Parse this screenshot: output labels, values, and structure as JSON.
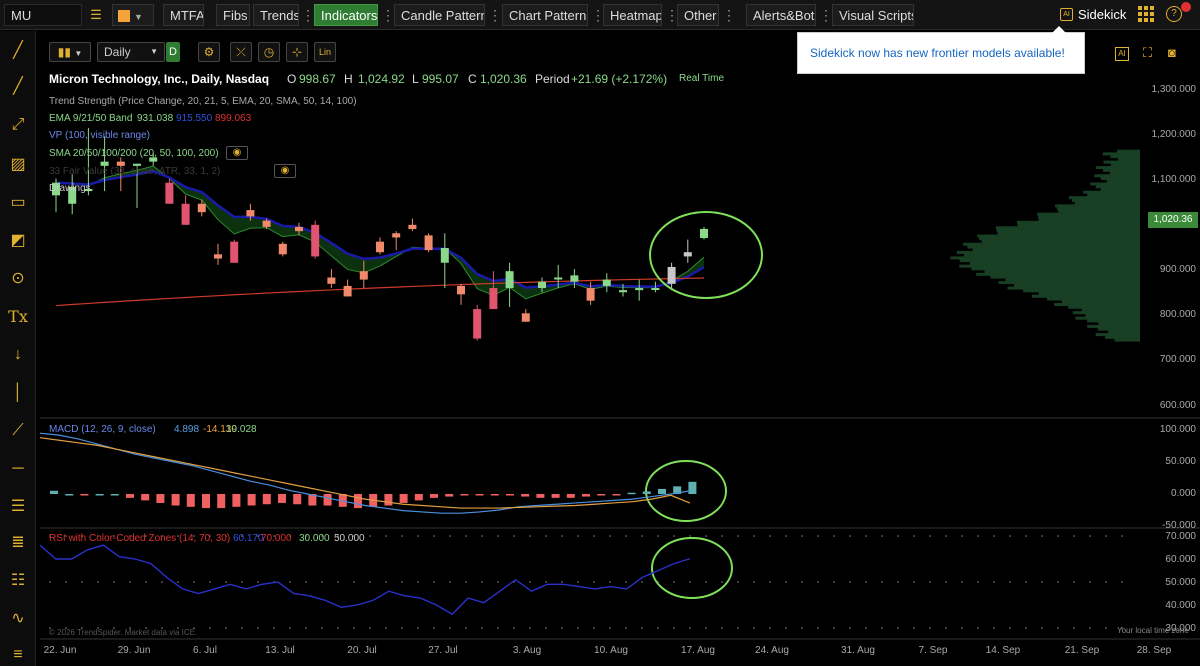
{
  "topbar": {
    "symbol": "MU",
    "buttons": [
      "MTFA",
      "Fibs",
      "Trends",
      "Indicators",
      "Candle Patterns",
      "Chart Patterns",
      "Heatmap",
      "Other",
      "Alerts&Bots",
      "Visual Scripts"
    ],
    "active": "Indicators",
    "sidekick": "Sidekick",
    "sidekick_ai_badge": "AI"
  },
  "toast": {
    "message": "Sidekick now has new frontier models available!"
  },
  "controls": {
    "interval": "Daily",
    "interval_badge": "D",
    "scale_badge": "Lin"
  },
  "header": {
    "title": "Micron Technology, Inc., Daily, Nasdaq",
    "o_label": "O",
    "o_value": "998.67",
    "h_label": "H",
    "h_value": "1,024.92",
    "l_label": "L",
    "l_value": "995.07",
    "c_label": "C",
    "c_value": "1,020.36",
    "period_label": "Period",
    "period_value": "+21.69 (+2.172%)",
    "realtime": "Real Time"
  },
  "legend": {
    "trend": "Trend Strength (Price Change, 20, 21, 5, EMA, 20, SMA, 50, 14, 100)",
    "ema_label": "EMA 9/21/50 Band",
    "ema_v1": "931.038",
    "ema_v2": "915.550",
    "ema_v3": "899.063",
    "vp": "VP (100, visible range)",
    "sma": "SMA 20/50/100/200 (20, 50, 100, 200)",
    "fair": "33 Fair Value (33, close, ATR, 33, 1, 2)",
    "drawings": "Drawings"
  },
  "price_axis": {
    "ticks": [
      "1,300.000",
      "1,200.000",
      "1,100.000",
      "900.000",
      "800.000",
      "700.000",
      "600.000"
    ],
    "last_price_badge": "1,020.36"
  },
  "macd": {
    "label": "MACD (12, 26, 9, close)",
    "v1": "4.898",
    "v2": "-14.130",
    "v3": "19.028",
    "ticks": [
      "100.000",
      "50.000",
      "0.000",
      "-50.000"
    ]
  },
  "rsi": {
    "label": "RSI with Color-Coded Zones (14, 70, 30)",
    "v1": "60.170",
    "v2": "70.000",
    "v3": "30.000",
    "v4": "50.000",
    "ticks": [
      "70.000",
      "60.000",
      "50.000",
      "40.000",
      "30.000"
    ]
  },
  "x_axis": [
    "22. Jun",
    "29. Jun",
    "6. Jul",
    "13. Jul",
    "20. Jul",
    "27. Jul",
    "3. Aug",
    "10. Aug",
    "17. Aug",
    "24. Aug",
    "31. Aug",
    "7. Sep",
    "14. Sep",
    "21. Sep",
    "28. Sep"
  ],
  "footer": {
    "copyright": "© 2026 TrendSpider. Market data via ICE.",
    "timezone": "Your local time zone"
  },
  "colors": {
    "up": "#8bd88b",
    "up_gray": "#c8c8c8",
    "down": "#f08a6a",
    "down_red": "#e05470",
    "ema_blue": "#1a1aa8",
    "ema_green": "#2c8a2c",
    "sma_red": "#d03a2a",
    "highlight": "#7fe05a"
  },
  "chart_data": {
    "type": "candlestick",
    "candles": [
      {
        "date": "22. Jun",
        "o": 1100,
        "h": 1140,
        "l": 1060,
        "c": 1130
      },
      {
        "date": "23. Jun",
        "o": 1080,
        "h": 1150,
        "l": 1055,
        "c": 1120
      },
      {
        "date": "24. Jun",
        "o": 1110,
        "h": 1260,
        "l": 1100,
        "c": 1115
      },
      {
        "date": "25. Jun",
        "o": 1170,
        "h": 1240,
        "l": 1110,
        "c": 1180
      },
      {
        "date": "26. Jun",
        "o": 1180,
        "h": 1190,
        "l": 1110,
        "c": 1170
      },
      {
        "date": "29. Jun",
        "o": 1170,
        "h": 1175,
        "l": 1070,
        "c": 1175
      },
      {
        "date": "30. Jun",
        "o": 1180,
        "h": 1200,
        "l": 1170,
        "c": 1190
      },
      {
        "date": "1. Jul",
        "o": 1130,
        "h": 1140,
        "l": 1080,
        "c": 1080
      },
      {
        "date": "2. Jul",
        "o": 1080,
        "h": 1100,
        "l": 1030,
        "c": 1030
      },
      {
        "date": "6. Jul",
        "o": 1080,
        "h": 1090,
        "l": 1050,
        "c": 1060
      },
      {
        "date": "7. Jul",
        "o": 960,
        "h": 985,
        "l": 935,
        "c": 950
      },
      {
        "date": "8. Jul",
        "o": 990,
        "h": 995,
        "l": 940,
        "c": 940
      },
      {
        "date": "9. Jul",
        "o": 1065,
        "h": 1080,
        "l": 1040,
        "c": 1050
      },
      {
        "date": "10. Jul",
        "o": 1040,
        "h": 1045,
        "l": 1020,
        "c": 1025
      },
      {
        "date": "13. Jul",
        "o": 985,
        "h": 990,
        "l": 955,
        "c": 960
      },
      {
        "date": "14. Jul",
        "o": 1025,
        "h": 1035,
        "l": 1005,
        "c": 1015
      },
      {
        "date": "15. Jul",
        "o": 1030,
        "h": 1040,
        "l": 950,
        "c": 955
      },
      {
        "date": "16. Jul",
        "o": 905,
        "h": 925,
        "l": 880,
        "c": 890
      },
      {
        "date": "17. Jul",
        "o": 885,
        "h": 900,
        "l": 860,
        "c": 860
      },
      {
        "date": "20. Jul",
        "o": 920,
        "h": 945,
        "l": 880,
        "c": 900
      },
      {
        "date": "21. Jul",
        "o": 990,
        "h": 1000,
        "l": 960,
        "c": 965
      },
      {
        "date": "22. Jul",
        "o": 1010,
        "h": 1015,
        "l": 970,
        "c": 1000
      },
      {
        "date": "23. Jul",
        "o": 1030,
        "h": 1045,
        "l": 1015,
        "c": 1020
      },
      {
        "date": "24. Jul",
        "o": 1005,
        "h": 1010,
        "l": 965,
        "c": 970
      },
      {
        "date": "27. Jul",
        "o": 940,
        "h": 1010,
        "l": 880,
        "c": 975
      },
      {
        "date": "28. Jul",
        "o": 885,
        "h": 890,
        "l": 840,
        "c": 865
      },
      {
        "date": "29. Jul",
        "o": 830,
        "h": 840,
        "l": 755,
        "c": 760
      },
      {
        "date": "30. Jul",
        "o": 880,
        "h": 920,
        "l": 840,
        "c": 830
      },
      {
        "date": "31. Jul",
        "o": 880,
        "h": 940,
        "l": 835,
        "c": 920
      },
      {
        "date": "3. Aug",
        "o": 820,
        "h": 830,
        "l": 800,
        "c": 800
      },
      {
        "date": "4. Aug",
        "o": 880,
        "h": 905,
        "l": 870,
        "c": 895
      },
      {
        "date": "5. Aug",
        "o": 905,
        "h": 935,
        "l": 880,
        "c": 905
      },
      {
        "date": "6. Aug",
        "o": 895,
        "h": 925,
        "l": 880,
        "c": 910
      },
      {
        "date": "7. Aug",
        "o": 880,
        "h": 895,
        "l": 840,
        "c": 850
      },
      {
        "date": "10. Aug",
        "o": 885,
        "h": 915,
        "l": 870,
        "c": 900
      },
      {
        "date": "11. Aug",
        "o": 870,
        "h": 890,
        "l": 860,
        "c": 875
      },
      {
        "date": "12. Aug",
        "o": 875,
        "h": 900,
        "l": 850,
        "c": 880
      },
      {
        "date": "13. Aug",
        "o": 880,
        "h": 895,
        "l": 870,
        "c": 880
      },
      {
        "date": "14. Aug",
        "o": 890,
        "h": 940,
        "l": 875,
        "c": 930
      },
      {
        "date": "17. Aug",
        "o": 955,
        "h": 995,
        "l": 940,
        "c": 965
      },
      {
        "date": "18. Aug",
        "o": 998.67,
        "h": 1024.92,
        "l": 995.07,
        "c": 1020.36
      }
    ],
    "price_range": [
      600,
      1350
    ],
    "macd_range": [
      -50,
      100
    ],
    "rsi_range": [
      30,
      70
    ],
    "macd_hist": [
      5,
      0,
      -2,
      0,
      0,
      -6,
      -10,
      -14,
      -18,
      -20,
      -22,
      -22,
      -20,
      -18,
      -16,
      -14,
      -16,
      -18,
      -18,
      -20,
      -22,
      -20,
      -18,
      -14,
      -10,
      -6,
      -4,
      -2,
      -2,
      -2,
      -2,
      -4,
      -6,
      -6,
      -6,
      -4,
      -2,
      -2,
      2,
      4,
      8,
      12,
      19
    ],
    "macd_line": [
      95,
      92,
      86,
      78,
      70,
      62,
      56,
      50,
      44,
      36,
      28,
      20,
      14,
      6,
      0,
      -6,
      -12,
      -18,
      -22,
      -26,
      -28,
      -30,
      -30,
      -28,
      -25,
      -20,
      -18,
      -16,
      -14,
      -12,
      -10,
      -8,
      -4,
      0,
      4.9
    ],
    "signal_line": [
      88,
      84,
      80,
      76,
      70,
      64,
      58,
      52,
      46,
      40,
      34,
      28,
      22,
      16,
      10,
      4,
      -2,
      -8,
      -12,
      -16,
      -18,
      -20,
      -22,
      -22,
      -22,
      -21,
      -20,
      -19,
      -18,
      -16,
      -14,
      -12,
      -8,
      -2,
      -14.1
    ],
    "rsi_values": [
      66,
      60,
      60,
      64,
      66,
      61,
      60,
      58,
      52,
      47,
      45,
      47,
      49,
      47,
      49,
      50,
      45,
      44,
      42,
      39,
      40,
      42,
      46,
      44,
      43,
      40,
      36,
      43,
      41,
      46,
      51,
      46,
      49,
      49,
      48,
      47,
      48,
      47,
      52,
      55,
      58,
      60.17
    ]
  }
}
